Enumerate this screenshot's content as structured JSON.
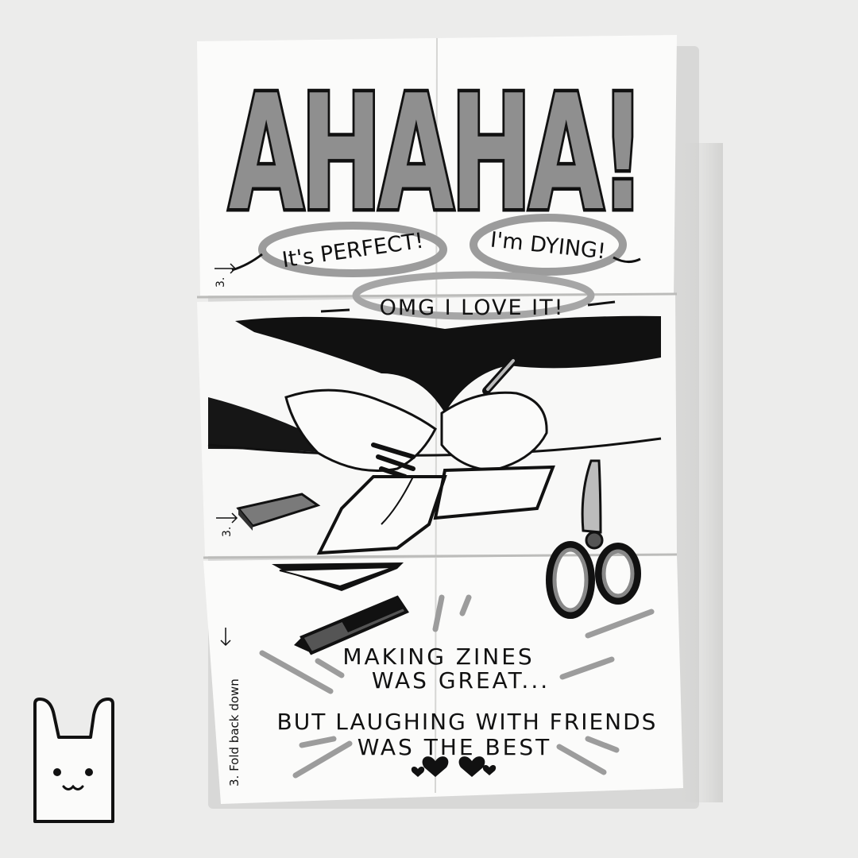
{
  "zine": {
    "title": "AHAHA!",
    "bubbles": {
      "left": "It's PERFECT!",
      "right": "I'm DYING!",
      "center": "OMG I LOVE IT!"
    },
    "fold_marks": {
      "top": "3.",
      "middle": "3.",
      "bottom": "3. Fold back down"
    },
    "caption": {
      "line1": "MAKING ZINES",
      "line2": "WAS GREAT...",
      "line3": "BUT LAUGHING WITH FRIENDS",
      "line4": "WAS THE BEST"
    }
  },
  "colors": {
    "background": "#ececeb",
    "paper": "#fbfbfa",
    "ink": "#111111",
    "marker_gray": "#8a8a8a"
  },
  "icons": [
    "bunny-logo-icon",
    "hearts-icon",
    "scissors-icon",
    "marker-icon",
    "eraser-icon",
    "hands-icon"
  ]
}
